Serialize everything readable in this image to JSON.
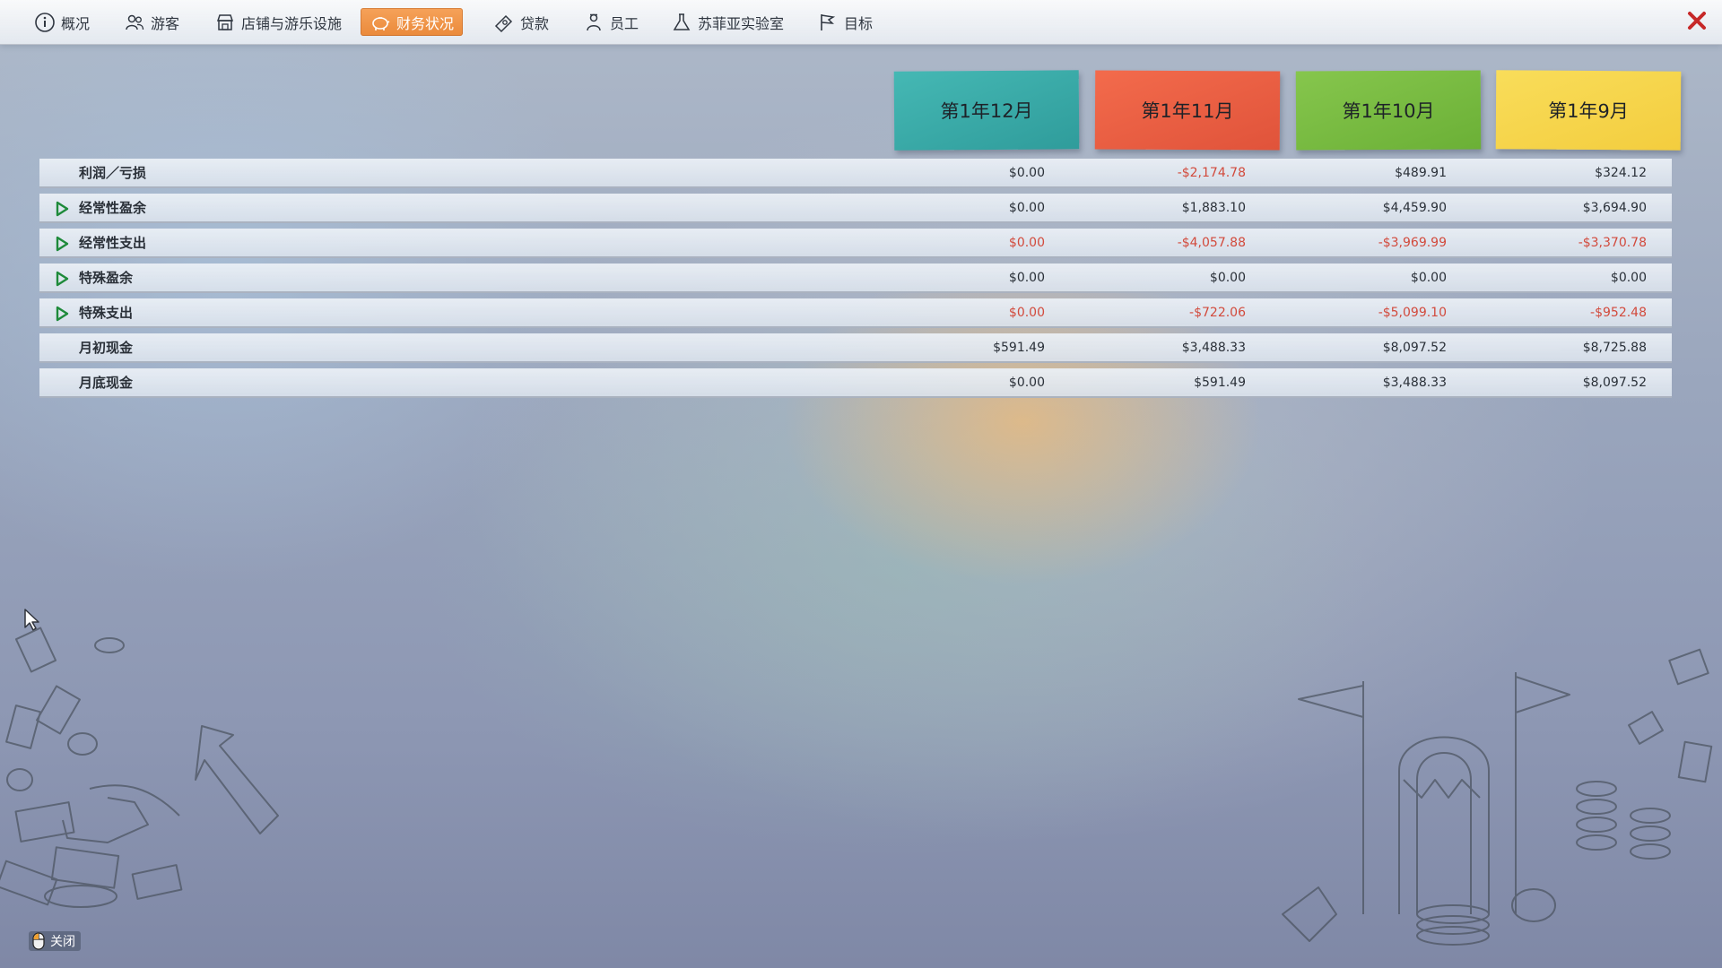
{
  "nav": {
    "tabs": [
      {
        "label": "概况",
        "icon": "info-icon",
        "active": false
      },
      {
        "label": "游客",
        "icon": "visitors-icon",
        "active": false
      },
      {
        "label": "店铺与游乐设施",
        "icon": "shop-icon",
        "active": false
      },
      {
        "label": "财务状况",
        "icon": "piggy-bank-icon",
        "active": true
      },
      {
        "label": "贷款",
        "icon": "loan-icon",
        "active": false
      },
      {
        "label": "员工",
        "icon": "staff-icon",
        "active": false
      },
      {
        "label": "苏菲亚实验室",
        "icon": "flask-icon",
        "active": false
      },
      {
        "label": "目标",
        "icon": "flag-icon",
        "active": false
      }
    ],
    "accent_color": "#ef9447",
    "close_icon": "close-x-icon"
  },
  "months": [
    {
      "label": "第1年12月",
      "color": "#3aaaa8"
    },
    {
      "label": "第1年11月",
      "color": "#ea5e43"
    },
    {
      "label": "第1年10月",
      "color": "#78bb41"
    },
    {
      "label": "第1年9月",
      "color": "#f6d54b"
    }
  ],
  "finance": {
    "rows": [
      {
        "label": "利润／亏损",
        "expandable": false,
        "values": [
          "$0.00",
          "-$2,174.78",
          "$489.91",
          "$324.12"
        ]
      },
      {
        "label": "经常性盈余",
        "expandable": true,
        "values": [
          "$0.00",
          "$1,883.10",
          "$4,459.90",
          "$3,694.90"
        ]
      },
      {
        "label": "经常性支出",
        "expandable": true,
        "values": [
          "$0.00",
          "-$4,057.88",
          "-$3,969.99",
          "-$3,370.78"
        ]
      },
      {
        "label": "特殊盈余",
        "expandable": true,
        "values": [
          "$0.00",
          "$0.00",
          "$0.00",
          "$0.00"
        ]
      },
      {
        "label": "特殊支出",
        "expandable": true,
        "values": [
          "$0.00",
          "-$722.06",
          "-$5,099.10",
          "-$952.48"
        ]
      },
      {
        "label": "月初现金",
        "expandable": false,
        "values": [
          "$591.49",
          "$3,488.33",
          "$8,097.52",
          "$8,725.88"
        ]
      },
      {
        "label": "月底现金",
        "expandable": false,
        "values": [
          "$0.00",
          "$591.49",
          "$3,488.33",
          "$8,097.52"
        ]
      }
    ],
    "negative_color": "#d24a3c",
    "row_color_negative": [
      false,
      false,
      true,
      false,
      true,
      false,
      false
    ]
  },
  "footer": {
    "close_hint": "关闭",
    "close_hint_icon": "mouse-icon"
  }
}
